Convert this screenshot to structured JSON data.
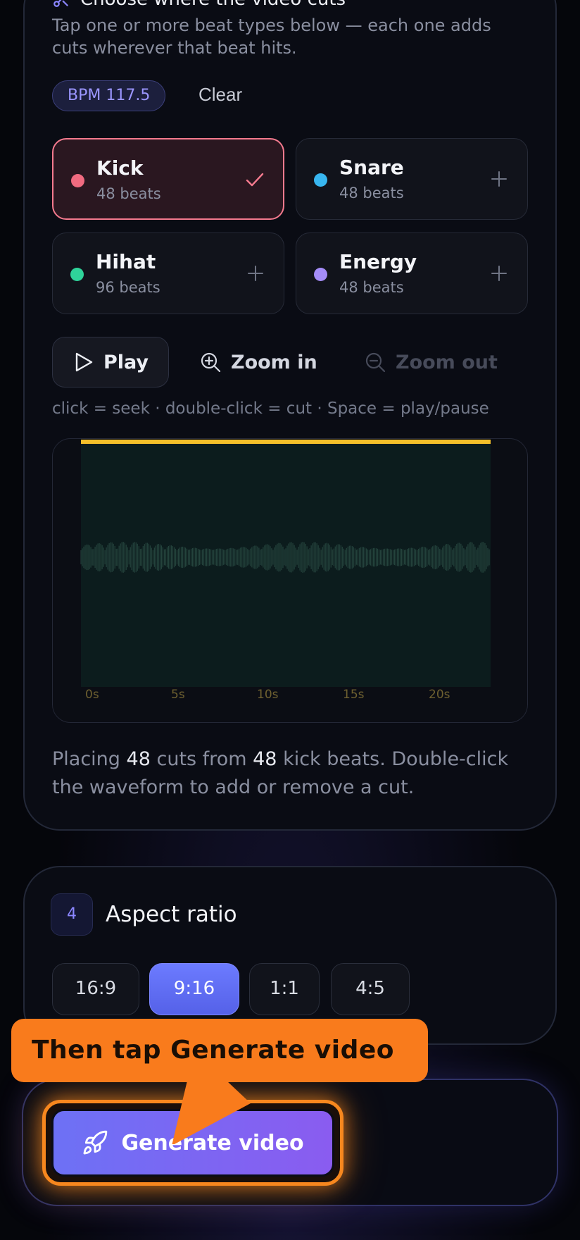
{
  "beat_section": {
    "title": "Choose where the video cuts",
    "instructions": "Tap one or more beat types below — each one adds cuts wherever that beat hits.",
    "bpm_badge": "BPM 117.5",
    "clear_label": "Clear",
    "beats": [
      {
        "name": "Kick",
        "count": "48 beats",
        "color": "#f06b80",
        "selected": true,
        "action_icon": "check-icon"
      },
      {
        "name": "Snare",
        "count": "48 beats",
        "color": "#38b6f0",
        "selected": false,
        "action_icon": "plus-icon"
      },
      {
        "name": "Hihat",
        "count": "96 beats",
        "color": "#2fd39a",
        "selected": false,
        "action_icon": "plus-icon"
      },
      {
        "name": "Energy",
        "count": "48 beats",
        "color": "#a48cf8",
        "selected": false,
        "action_icon": "plus-icon"
      }
    ],
    "play_label": "Play",
    "zoom_in_label": "Zoom in",
    "zoom_out_label": "Zoom out",
    "hint": "click = seek · double-click = cut · Space = play/pause",
    "waveform": {
      "time_labels": [
        "0s",
        "5s",
        "10s",
        "15s",
        "20s"
      ],
      "cut_count": 48,
      "cut_color": "#f5c02a"
    },
    "summary": {
      "prefix": "Placing",
      "cuts": "48",
      "middle": "cuts from",
      "beats": "48",
      "suffix": "kick beats. Double-click the waveform to add or remove a cut."
    }
  },
  "aspect_section": {
    "step_number": "4",
    "title": "Aspect ratio",
    "options": [
      "16:9",
      "9:16",
      "1:1",
      "4:5"
    ],
    "selected": "9:16"
  },
  "generate_section": {
    "button_label": "Generate video",
    "tooltip": "Then tap Generate video"
  }
}
